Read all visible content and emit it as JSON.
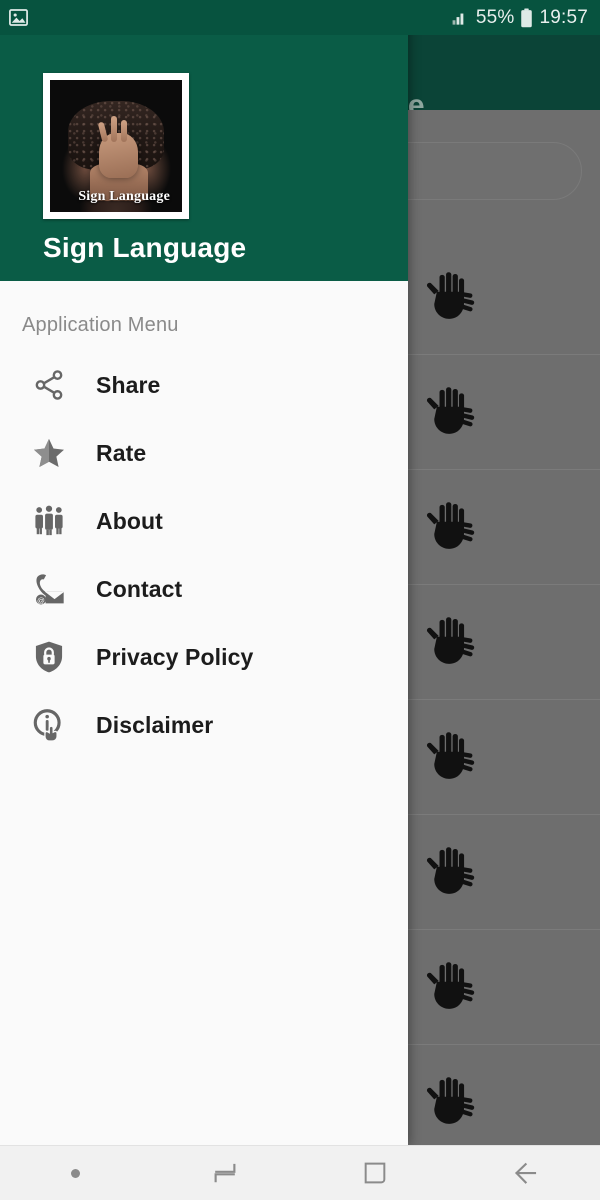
{
  "status_bar": {
    "notification_icon": "gallery-image-icon",
    "signal_icon": "signal-bars-icon",
    "battery_percent": "55%",
    "battery_icon": "battery-icon",
    "clock": "19:57",
    "background_color": "#07533f",
    "text_color": "#e8efed"
  },
  "drawer": {
    "header": {
      "background_color": "#0a5c46",
      "logo": {
        "icon": "sign-language-photo",
        "caption": "Sign Language"
      },
      "app_title": "Sign Language"
    },
    "menu_caption": "Application Menu",
    "items": [
      {
        "label": "Share",
        "icon": "share-icon"
      },
      {
        "label": "Rate",
        "icon": "star-icon"
      },
      {
        "label": "About",
        "icon": "people-group-icon"
      },
      {
        "label": "Contact",
        "icon": "phone-envelope-icon"
      },
      {
        "label": "Privacy Policy",
        "icon": "shield-lock-icon"
      },
      {
        "label": "Disclaimer",
        "icon": "info-hand-icon"
      }
    ],
    "background_color": "#fafafa"
  },
  "background_app": {
    "app_bar_title": "anguage",
    "app_bar_color": "#0b4437",
    "search_placeholder": "",
    "scrim_color": "#6e6e6e",
    "grid_item_icon": "hands-sign-icon",
    "grid_rows": 8,
    "grid_columns": 2
  },
  "nav_bar": {
    "background_color": "#f1f1f1",
    "buttons": [
      {
        "name": "dot-indicator",
        "icon": "dot-icon"
      },
      {
        "name": "recents",
        "icon": "recents-icon"
      },
      {
        "name": "home",
        "icon": "home-square-icon"
      },
      {
        "name": "back",
        "icon": "back-arrow-icon"
      }
    ]
  }
}
